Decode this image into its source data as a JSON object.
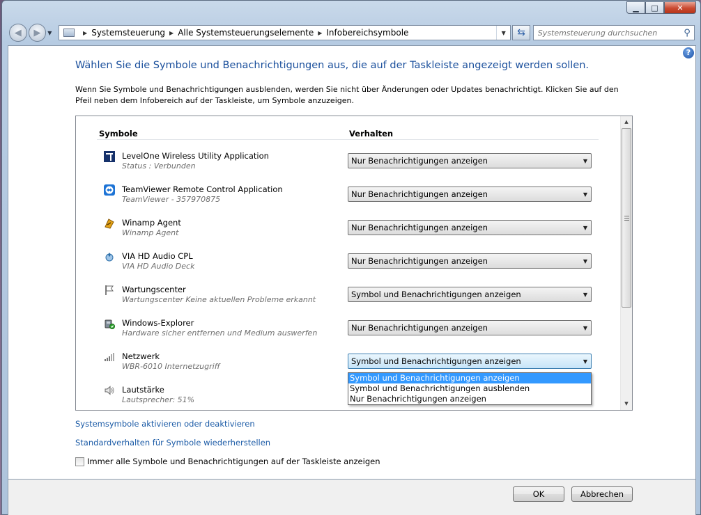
{
  "window": {
    "minimize": "▁",
    "maximize": "□",
    "close": "✕"
  },
  "nav": {
    "back_icon": "back-arrow-icon",
    "forward_icon": "forward-arrow-icon",
    "breadcrumbs": [
      "Systemsteuerung",
      "Alle Systemsteuerungselemente",
      "Infobereichsymbole"
    ],
    "search_placeholder": "Systemsteuerung durchsuchen"
  },
  "page": {
    "title": "Wählen Sie die Symbole und Benachrichtigungen aus, die auf der Taskleiste angezeigt werden sollen.",
    "description": "Wenn Sie Symbole und Benachrichtigungen ausblenden, werden Sie nicht über Änderungen oder Updates benachrichtigt. Klicken Sie auf den Pfeil neben dem Infobereich auf der Taskleiste, um Symbole anzuzeigen.",
    "col_symbols": "Symbole",
    "col_behavior": "Verhalten"
  },
  "rows": [
    {
      "name": "LevelOne Wireless Utility Application",
      "sub": "Status : Verbunden",
      "value": "Nur Benachrichtigungen anzeigen",
      "icon": "levelone-icon"
    },
    {
      "name": "TeamViewer Remote Control Application",
      "sub": "TeamViewer - 357970875",
      "value": "Nur Benachrichtigungen anzeigen",
      "icon": "teamviewer-icon"
    },
    {
      "name": "Winamp Agent",
      "sub": "Winamp Agent",
      "value": "Nur Benachrichtigungen anzeigen",
      "icon": "winamp-icon"
    },
    {
      "name": "VIA HD Audio CPL",
      "sub": "VIA HD Audio Deck",
      "value": "Nur Benachrichtigungen anzeigen",
      "icon": "via-audio-icon"
    },
    {
      "name": "Wartungscenter",
      "sub": "Wartungscenter  Keine aktuellen Probleme erkannt",
      "value": "Symbol und Benachrichtigungen anzeigen",
      "icon": "flag-icon"
    },
    {
      "name": "Windows-Explorer",
      "sub": "Hardware sicher entfernen und Medium auswerfen",
      "value": "Nur Benachrichtigungen anzeigen",
      "icon": "safely-remove-icon"
    },
    {
      "name": "Netzwerk",
      "sub": "WBR-6010 Internetzugriff",
      "value": "Symbol und Benachrichtigungen anzeigen",
      "icon": "network-icon"
    },
    {
      "name": "Lautstärke",
      "sub": "Lautsprecher: 51%",
      "value": "",
      "icon": "speaker-icon"
    }
  ],
  "dropdown_options": [
    "Symbol und Benachrichtigungen anzeigen",
    "Symbol und Benachrichtigungen ausblenden",
    "Nur Benachrichtigungen anzeigen"
  ],
  "links": {
    "system_icons": "Systemsymbole aktivieren oder deaktivieren",
    "restore_defaults": "Standardverhalten für Symbole wiederherstellen"
  },
  "checkbox_label": "Immer alle Symbole und Benachrichtigungen auf der Taskleiste anzeigen",
  "buttons": {
    "ok": "OK",
    "cancel": "Abbrechen"
  }
}
